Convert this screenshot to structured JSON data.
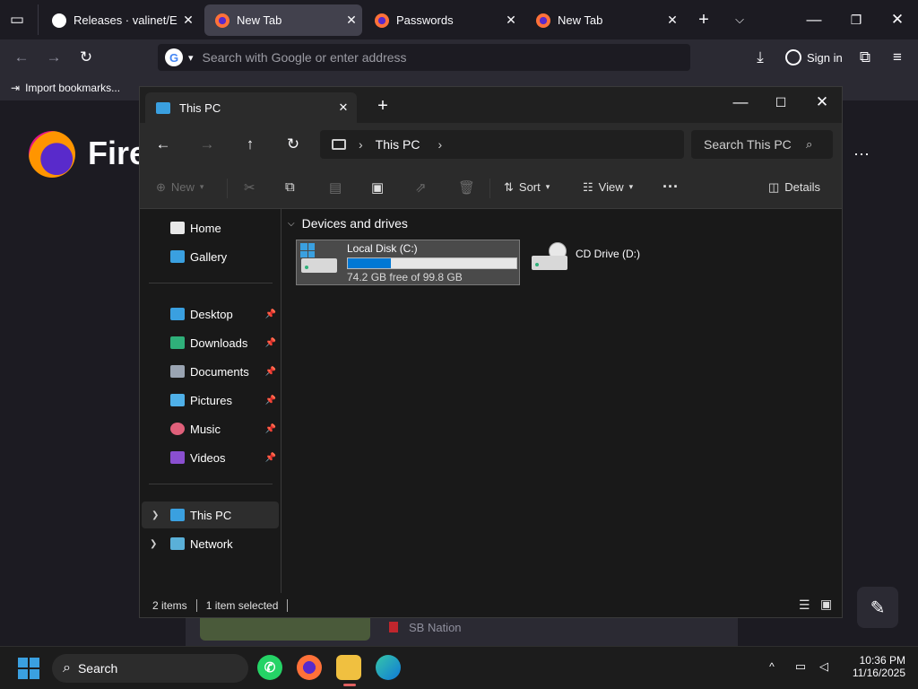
{
  "firefox": {
    "tabs": [
      {
        "title": "Releases · valinet/Explo",
        "icon": "github-icon",
        "active": false
      },
      {
        "title": "New Tab",
        "icon": "firefox-icon",
        "active": true
      },
      {
        "title": "Passwords",
        "icon": "firefox-icon",
        "active": false
      },
      {
        "title": "New Tab",
        "icon": "firefox-icon",
        "active": false
      }
    ],
    "url_placeholder": "Search with Google or enter address",
    "sign_in": "Sign in",
    "import_bookmarks": "Import bookmarks...",
    "wordmark": "Fire",
    "shortcut_label": "SB Nation"
  },
  "explorer": {
    "tab_title": "This PC",
    "breadcrumb": "This PC",
    "search_placeholder": "Search This PC",
    "commands": {
      "new": "New",
      "sort": "Sort",
      "view": "View",
      "details": "Details"
    },
    "sidebar": {
      "top": [
        {
          "label": "Home"
        },
        {
          "label": "Gallery"
        }
      ],
      "pinned": [
        {
          "label": "Desktop"
        },
        {
          "label": "Downloads"
        },
        {
          "label": "Documents"
        },
        {
          "label": "Pictures"
        },
        {
          "label": "Music"
        },
        {
          "label": "Videos"
        }
      ],
      "tree": [
        {
          "label": "This PC"
        },
        {
          "label": "Network"
        }
      ]
    },
    "group_title": "Devices and drives",
    "drives": [
      {
        "name": "Local Disk (C:)",
        "free_text": "74.2 GB free of 99.8 GB",
        "used_fraction": 0.257
      },
      {
        "name": "CD Drive (D:)"
      }
    ],
    "status": {
      "items": "2 items",
      "selected": "1 item selected"
    }
  },
  "taskbar": {
    "search": "Search",
    "time": "10:36 PM",
    "date": "11/16/2025"
  },
  "colors": {
    "accent": "#0078d4",
    "selection": "#4a4a4a"
  }
}
